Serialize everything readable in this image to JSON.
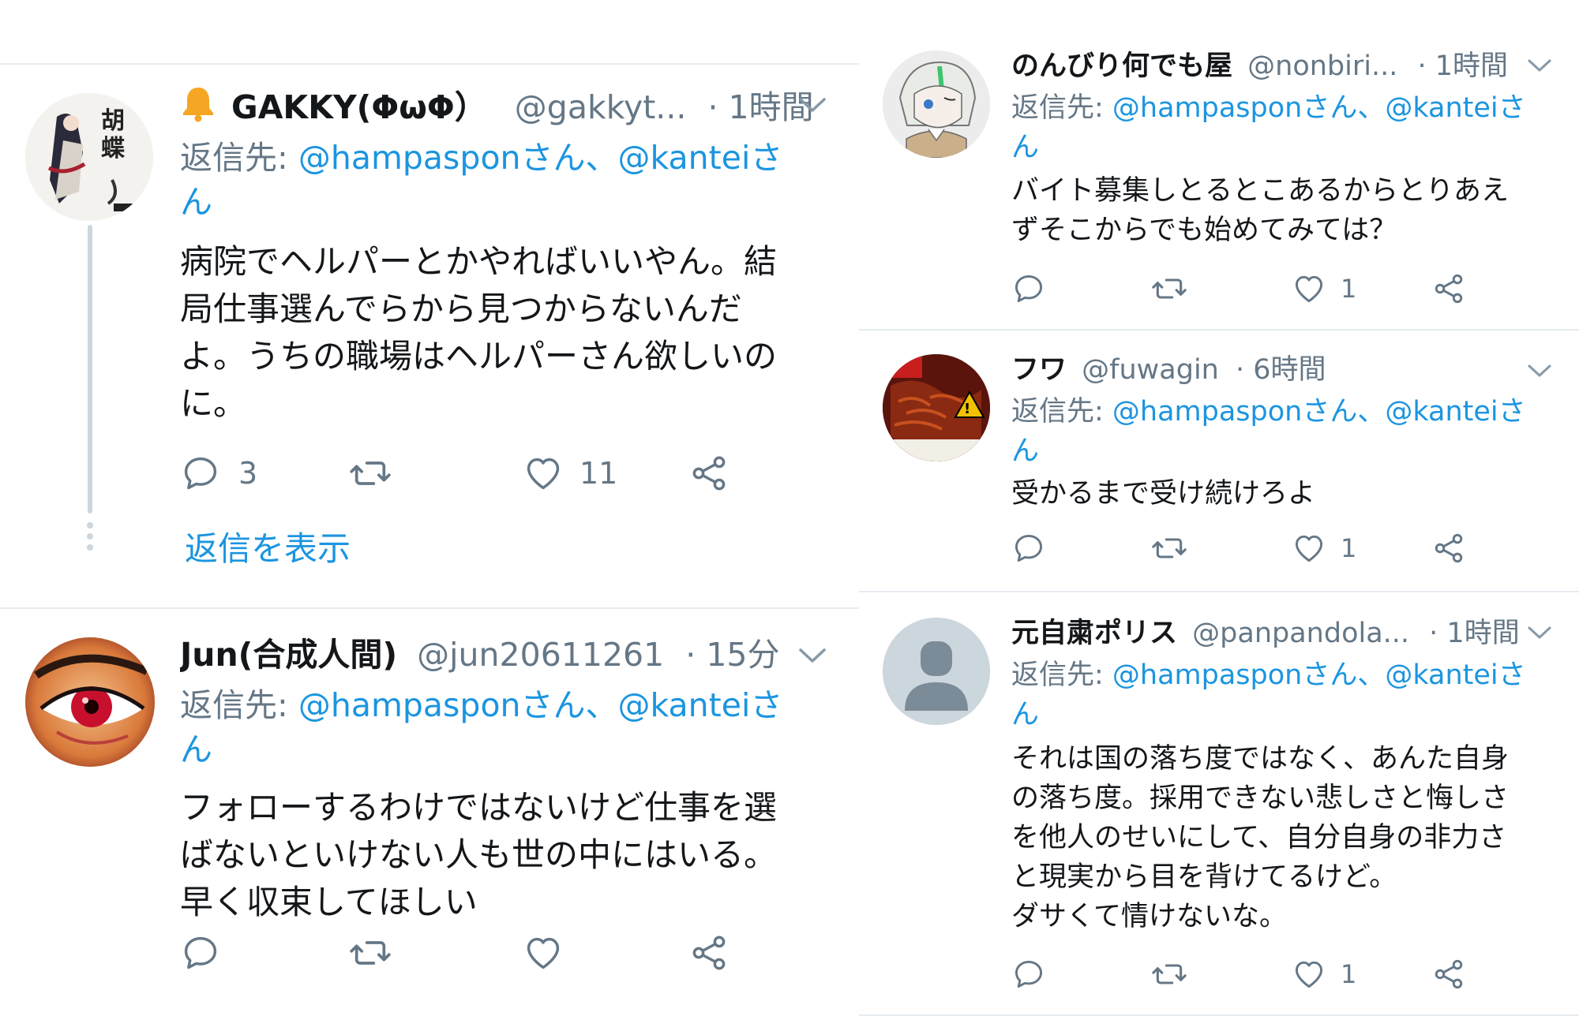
{
  "left": {
    "tweets": [
      {
        "name": "GAKKY(ΦωΦ）",
        "handle": "@gakkyt...",
        "time": "· 1時間",
        "reply_prefix": "返信先: ",
        "mention1": "@hampasponさん、",
        "mention2": "@kanteiさ",
        "mention_tail": "ん",
        "text": "病院でヘルパーとかやればいいやん。結\n局仕事選んでらから見つからないんだ\nよ。うちの職場はヘルパーさん欲しいの\nに。",
        "reply_count": "3",
        "retweet_count": "",
        "like_count": "11",
        "show_replies": "返信を表示"
      },
      {
        "name": "Jun(合成人間)",
        "handle": "@jun20611261",
        "time": "· 15分",
        "reply_prefix": "返信先: ",
        "mention1": "@hampasponさん、",
        "mention2": "@kanteiさ",
        "mention_tail": "ん",
        "text": "フォローするわけではないけど仕事を選\nばないといけない人も世の中にはいる。\n早く収束してほしい",
        "reply_count": "",
        "retweet_count": "",
        "like_count": ""
      }
    ]
  },
  "right": {
    "tweets": [
      {
        "name": "のんびり何でも屋",
        "handle": "@nonbiri...",
        "time": "· 1時間",
        "reply_prefix": "返信先: ",
        "mention1": "@hampasponさん、",
        "mention2": "@kanteiさ",
        "mention_tail": "ん",
        "text": "バイト募集しとるとこあるからとりあえ\nずそこからでも始めてみては？",
        "reply_count": "",
        "retweet_count": "",
        "like_count": "1"
      },
      {
        "name": "フワ",
        "handle": "@fuwagin",
        "time": "· 6時間",
        "reply_prefix": "返信先: ",
        "mention1": "@hampasponさん、",
        "mention2": "@kanteiさ",
        "mention_tail": "ん",
        "text": "受かるまで受け続けろよ",
        "reply_count": "",
        "retweet_count": "",
        "like_count": "1"
      },
      {
        "name": "元自粛ポリス",
        "handle": "@panpandola...",
        "time": "· 1時間",
        "reply_prefix": "返信先: ",
        "mention1": "@hampasponさん、",
        "mention2": "@kanteiさ",
        "mention_tail": "ん",
        "text": "それは国の落ち度ではなく、あんた自身\nの落ち度。採用できない悲しさと悔しさ\nを他人のせいにして、自分自身の非力さ\nと現実から目を背けてるけど。\nダサくて情けないな。",
        "reply_count": "",
        "retweet_count": "",
        "like_count": "1"
      }
    ]
  },
  "icons": {
    "bell": "bell-icon",
    "reply": "reply-icon",
    "retweet": "retweet-icon",
    "like": "heart-icon",
    "share": "share-icon",
    "caret": "chevron-down-icon",
    "default_avatar": "default-avatar-icon"
  },
  "colors": {
    "link": "#1b95e0",
    "secondary": "#657786",
    "divider": "#e6ecf0",
    "bell": "#f5a623"
  }
}
